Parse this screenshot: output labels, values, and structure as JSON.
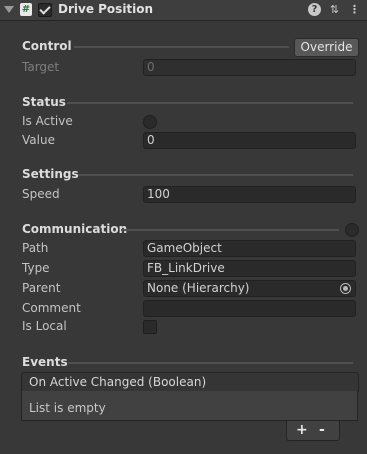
{
  "header": {
    "title": "Drive Position",
    "script_glyph": "#",
    "icons": [
      "foldout-arrow",
      "script-icon",
      "enable-checkbox",
      "help-icon",
      "presets-icon",
      "context-menu-icon"
    ],
    "help_glyph": "?",
    "presets_glyph": "⇅",
    "menu_glyph": "⋮"
  },
  "control": {
    "heading": "Control",
    "override_label": "Override",
    "target_label": "Target",
    "target_value": "0"
  },
  "status": {
    "heading": "Status",
    "is_active_label": "Is Active",
    "value_label": "Value",
    "value": "0"
  },
  "settings": {
    "heading": "Settings",
    "speed_label": "Speed",
    "speed_value": "100"
  },
  "communication": {
    "heading": "Communication",
    "path_label": "Path",
    "path_value": "GameObject",
    "type_label": "Type",
    "type_value": "FB_LinkDrive",
    "parent_label": "Parent",
    "parent_value": "None (Hierarchy)",
    "comment_label": "Comment",
    "comment_value": "",
    "is_local_label": "Is Local"
  },
  "events": {
    "heading": "Events",
    "list_title": "On Active Changed (Boolean)",
    "empty_text": "List is empty",
    "add_glyph": "+",
    "remove_glyph": "-"
  },
  "colors": {
    "background": "#383838",
    "field": "#2a2a2a",
    "button": "#585858"
  }
}
